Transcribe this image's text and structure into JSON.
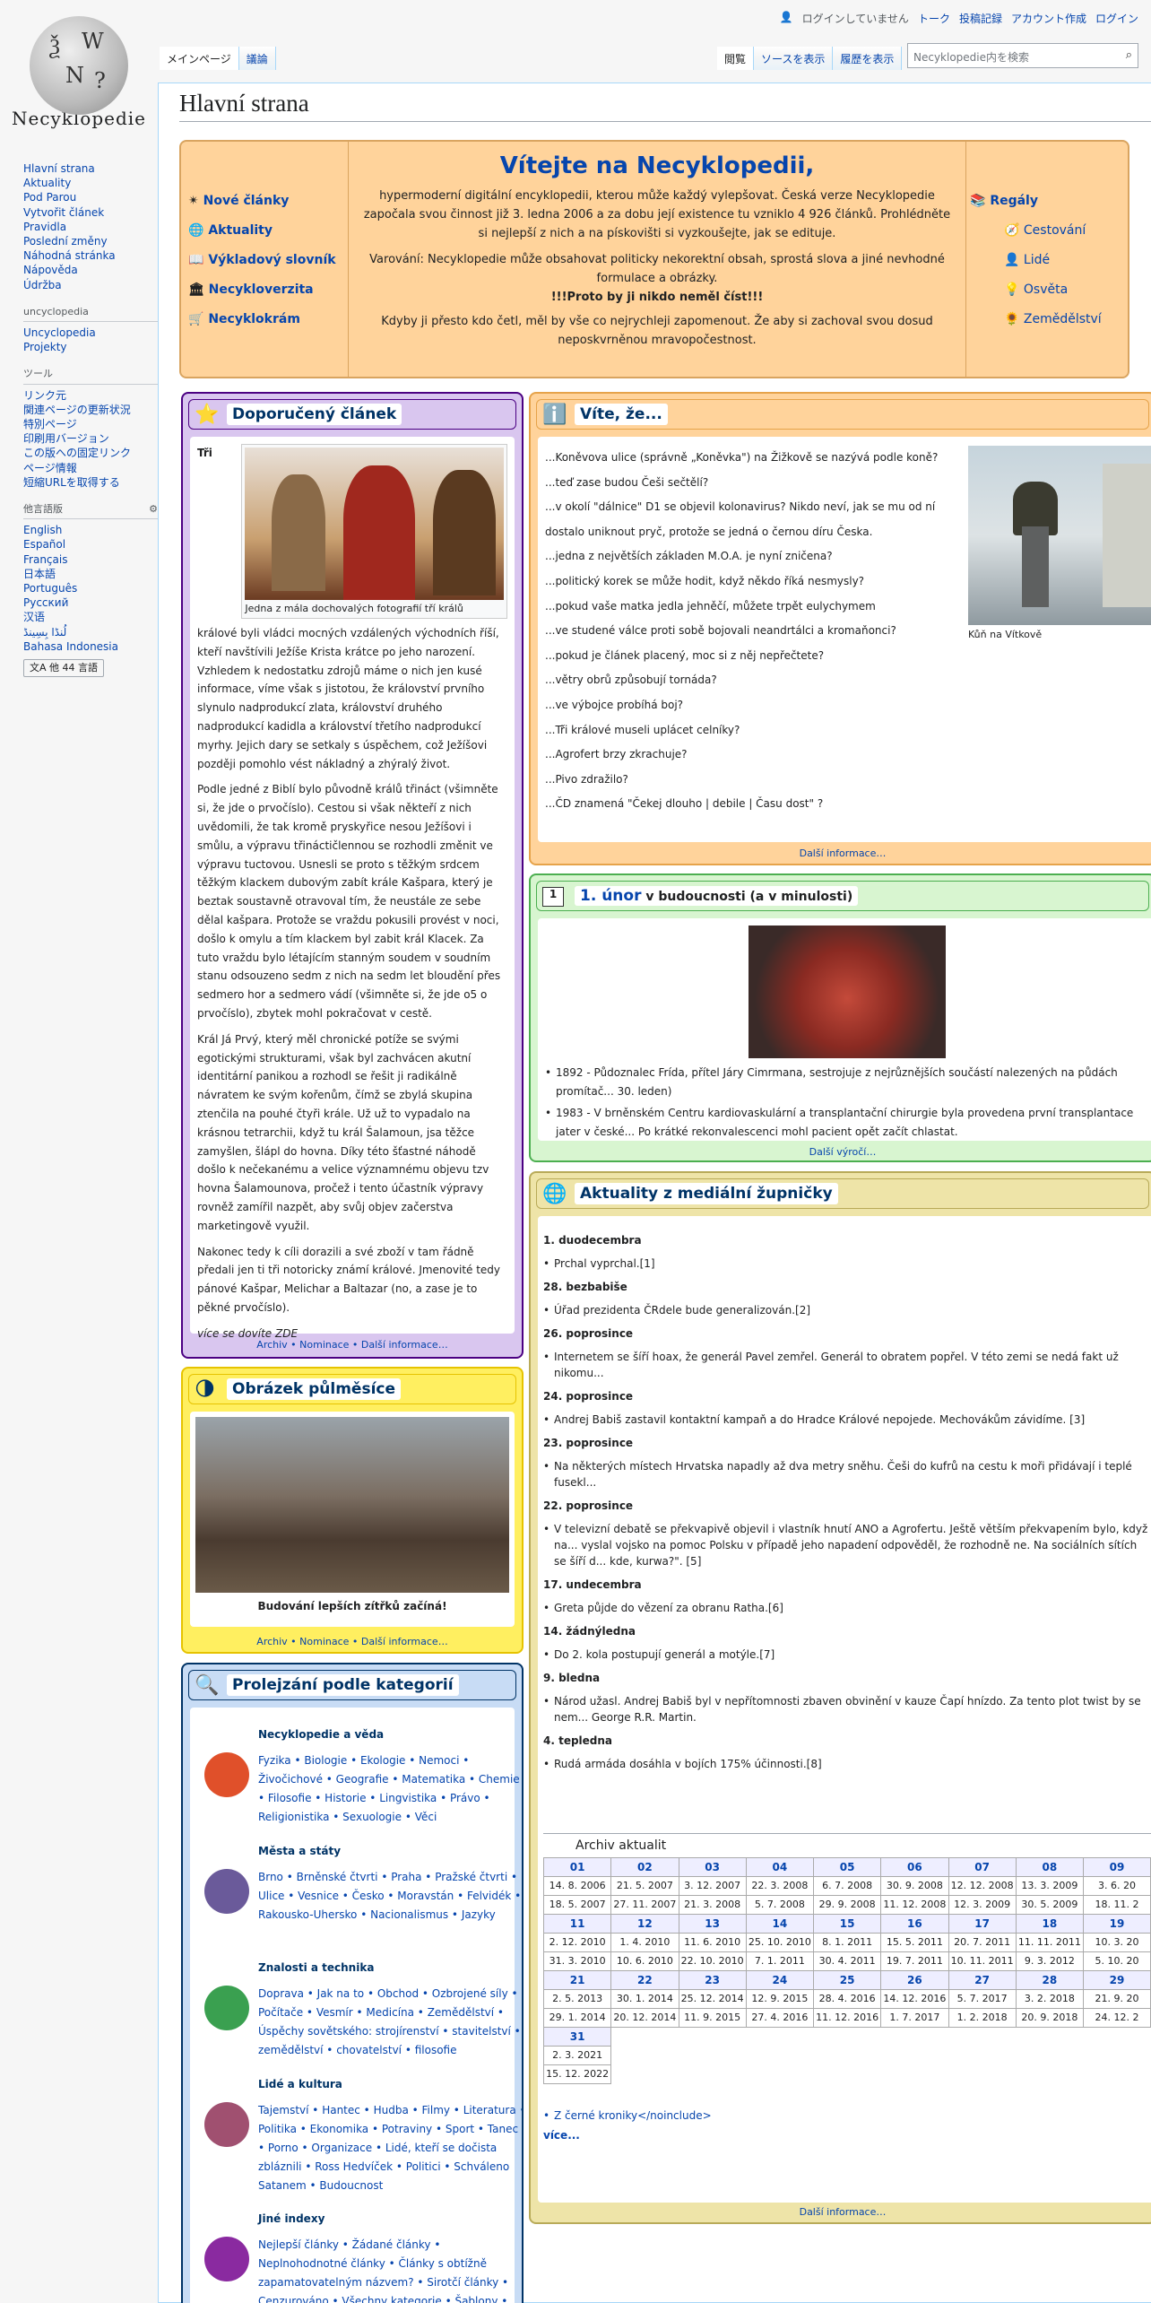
{
  "header": {
    "logo_word": "Necyklopedie",
    "personal": [
      "ログインしていません",
      "トーク",
      "投稿記録",
      "アカウント作成",
      "ログイン"
    ],
    "tabs_left": [
      "メインページ",
      "議論"
    ],
    "tabs_right": [
      "閲覧",
      "ソースを表示",
      "履歴を表示"
    ],
    "search_placeholder": "Necyklopedie内を検索"
  },
  "sidebar": {
    "main": [
      "Hlavní strana",
      "Aktuality",
      "Pod Parou",
      "Vytvořit článek",
      "Pravidla",
      "Poslední změny",
      "Náhodná stránka",
      "Nápověda",
      "Údržba"
    ],
    "uncy_head": "uncyclopedia",
    "uncy": [
      "Uncyclopedia",
      "Projekty"
    ],
    "tools_head": "ツール",
    "tools": [
      "リンク元",
      "関連ページの更新状況",
      "特別ページ",
      "印刷用バージョン",
      "この版への固定リンク",
      "ページ情報",
      "短縮URLを取得する"
    ],
    "lang_head": "他言語版",
    "langs": [
      "English",
      "Español",
      "Français",
      "日本語",
      "Português",
      "Русский",
      "汉语",
      "لُنڈا بِسِینڈ",
      "Bahasa Indonesia"
    ],
    "lang_button": "他 44 言語"
  },
  "page_title": "Hlavní strana",
  "welcome": {
    "title": "Vítejte na Necyklopedii,",
    "text1": "hypermoderní digitální encyklopedii, kterou může každý vylepšovat. Česká verze Necyklopedie započala svou činnost již 3. ledna 2006 a za dobu její existence tu vzniklo 4 926 článků. Prohlédněte si nejlepší z nich a na pískovišti si vyzkoušejte, jak se edituje.",
    "text2": "Varování: Necyklopedie může obsahovat politicky nekorektní obsah, sprostá slova a jiné nevhodné formulace a obrázky.",
    "text3": "!!!Proto by ji nikdo neměl číst!!!",
    "text4": "Kdyby ji přesto kdo četl, měl by vše co nejrychleji zapomenout. Že aby si zachoval svou dosud neposkvrněnou mravopočestnost.",
    "left": [
      "Nové články",
      "Aktuality",
      "Výkladový slovník",
      "Necykloverzita",
      "Necyklokrám"
    ],
    "right_head": "Regály",
    "right": [
      "Cestování",
      "Lidé",
      "Osvěta",
      "Zemědělství"
    ]
  },
  "featured": {
    "title": "Doporučený článek",
    "first": "Tři",
    "caption": "Jedna z mála dochovalých fotografií tří králů",
    "p1": "králové byli vládci mocných vzdálených východních říší, kteří navštívili Ježíše Krista krátce po jeho narození. Vzhledem k nedostatku zdrojů máme o nich jen kusé informace, víme však s jistotou, že království prvního slynulo nadprodukcí zlata, království druhého nadprodukcí kadidla a království třetího nadprodukcí myrhy. Jejich dary se setkaly s úspěchem, což Ježíšovi později pomohlo vést nákladný a zhýralý život.",
    "p2": "Podle jedné z Biblí bylo původně králů třináct (všimněte si, že jde o prvočíslo). Cestou si však někteří z nich uvědomili, že tak kromě pryskyřice nesou Ježíšovi i smůlu, a výpravu třináctičlennou se rozhodli změnit ve výpravu tuctovou. Usnesli se proto s těžkým srdcem těžkým klackem dubovým zabít krále Kašpara, který je beztak soustavně otravoval tím, že neustále ze sebe dělal kašpara. Protože se vraždu pokusili provést v noci, došlo k omylu a tím klackem byl zabit král Klacek. Za tuto vraždu bylo létajícím stanným soudem v soudním stanu odsouzeno sedm z nich na sedm let bloudění přes sedmero hor a sedmero vádí (všimněte si, že jde o5 o prvočíslo), zbytek mohl pokračovat v cestě.",
    "p3": "Král Já Prvý, který měl chronické potíže se svými egotickými strukturami, však byl zachvácen akutní identitární panikou a rozhodl se řešit ji radikálně návratem ke svým kořenům, čímž se zbylá skupina ztenčila na pouhé čtyři krále. Už už to vypadalo na krásnou tetrarchii, když tu král Šalamoun, jsa těžce zamyšlen, šlápl do hovna. Díky této šťastné náhodě došlo k nečekanému a velice významnému objevu tzv hovna Šalamounova, pročež i tento účastník výpravy rovněž zamířil nazpět, aby svůj objev začerstva marketingově využil.",
    "p4": "Nakonec tedy k cíli dorazili a své zboží v tam řádně předali jen ti tři notoricky známí králové. Jmenovité tedy pánové Kašpar, Melichar a Baltazar (no, a zase je to pěkné prvočíslo).",
    "more": "více se dovíte ZDE",
    "footer": "Archiv • Nominace • Další informace…"
  },
  "halfmoon": {
    "title": "Obrázek půlměsíce",
    "caption": "Budování lepších zítřků začíná!",
    "footer": "Archiv • Nominace • Další informace…"
  },
  "categories": {
    "title": "Prolejzání podle kategorií",
    "groups": [
      {
        "head": "Necyklopedie a věda",
        "items": "Fyzika • Biologie • Ekologie • Nemoci • Živočichové • Geografie • Matematika • Chemie • Filosofie • Historie • Lingvistika • Právo • Religionistika • Sexuologie • Věci"
      },
      {
        "head": "Města a státy",
        "items": "Brno • Brněnské čtvrti • Praha • Pražské čtvrti • Ulice • Vesnice • Česko • Moravstán • Felvidék • Rakousko-Uhersko • Nacionalismus • Jazyky"
      },
      {
        "head": "Znalosti a technika",
        "items": "Doprava • Jak na to • Obchod • Ozbrojené síly • Počítače • Vesmír • Medicína • Zemědělství • Úspěchy sovětského: strojírenství • stavitelství • zemědělství • chovatelství • filosofie"
      },
      {
        "head": "Lidé a kultura",
        "items": "Tajemství • Hantec • Hudba • Filmy • Literatura • Politika • Ekonomika • Potraviny • Sport • Tanec • Porno • Organizace • Lidé, kteří se dočista zbláznili • Ross Hedvíček • Politici • Schváleno Satanem • Budoucnost"
      },
      {
        "head": "Jiné indexy",
        "items": "Nejlepší články • Žádané články • Neplnohodnotné články • Články s obtížně zapamatovatelným názvem? • Sirotčí články • Cenzurováno • Všechny kategorie • Šablony •"
      }
    ]
  },
  "didyouknow": {
    "title": "Víte, že...",
    "items": [
      "...Koněvova ulice (správně „Koněvka\") na Žižkově se nazývá podle koně?",
      "...teď zase budou Češi sečtělí?",
      "...v okolí \"dálnice\" D1 se objevil kolonavirus? Nikdo neví, jak se mu od ní dostalo uniknout pryč, protože se jedná o černou díru Česka.",
      "...jedna z největších základen M.O.A. je nyní zničena?",
      "...politický korek se může hodit, když někdo říká nesmysly?",
      "...pokud vaše matka jedla jehněčí, můžete trpět eulychymem",
      "...ve studené válce proti sobě bojovali neandrtálci a kromaňonci?",
      "...pokud je článek placený, moc si z něj nepřečtete?",
      "...větry obrů způsobují tornáda?",
      "...ve výbojce probíhá boj?",
      "...Tři králové museli uplácet celníky?",
      "...Agrofert brzy zkrachuje?",
      "...Pivo zdražilo?",
      "...ČD znamená \"Čekej dlouho | debile | Času dost\" ?"
    ],
    "image_caption": "Kůň na Vítkově",
    "footer": "Další informace…"
  },
  "anniversary": {
    "day": "1",
    "title_link": "1. únor",
    "title_rest": " v budoucnosti (a v minulosti)",
    "items": [
      "1892 - Půdoznalec Frída, přítel Járy Cimrmana, sestrojuje z nejrůznějších součástí nalezených na půdách promítač... 30. leden)",
      "1983 - V brněnském Centru kardiovaskulární a transplantační chirurgie byla provedena první transplantace jater v české... Po krátké rekonvalescenci mohl pacient opět začít chlastat."
    ],
    "footer": "Další výročí…"
  },
  "news": {
    "title": "Aktuality z mediální župničky",
    "entries": [
      {
        "date": "1. duodecembra",
        "text": "Prchal vyprchal.[1]"
      },
      {
        "date": "28. bezbabiše",
        "text": "Úřad prezidenta ČRdele bude generalizován.[2]"
      },
      {
        "date": "26. poprosince",
        "text": "Internetem se šíří hoax, že generál Pavel zemřel. Generál to obratem popřel. V této zemi se nedá fakt už nikomu..."
      },
      {
        "date": "24. poprosince",
        "text": "Andrej Babiš zastavil kontaktní kampaň a do Hradce Králové nepojede. Mechovákům závidíme. [3]"
      },
      {
        "date": "23. poprosince",
        "text": "Na některých místech Hrvatska napadly až dva metry sněhu. Češi do kufrů na cestu k moři přidávají i teplé fusekl..."
      },
      {
        "date": "22. poprosince",
        "text": "V televizní debatě se překvapivě objevil i vlastník hnutí ANO a Agrofertu. Ještě větším překvapením bylo, když na... vyslal vojsko na pomoc Polsku v případě jeho napadení odpověděl, že rozhodně ne. Na sociálních sítích se šíří d... kde, kurwa?\". [5]"
      },
      {
        "date": "17. undecembra",
        "text": "Greta půjde do vězení za obranu Ratha.[6]"
      },
      {
        "date": "14. žádnýledna",
        "text": "Do 2. kola postupují generál a motýle.[7]"
      },
      {
        "date": "9. bledna",
        "text": "Národ užasl. Andrej Babiš byl v nepřítomnosti zbaven obvinění v kauze Čapí hnízdo. Za tento plot twist by se nem... George R.R. Martin."
      },
      {
        "date": "4. tepledna",
        "text": "Rudá armáda dosáhla v bojích 175% účinnosti.[8]"
      }
    ],
    "archive_title": "Archiv aktualit",
    "calendar": [
      {
        "nums": [
          "01",
          "02",
          "03",
          "04",
          "05",
          "06",
          "07",
          "08",
          "09"
        ],
        "r1": [
          "14. 8. 2006",
          "21. 5. 2007",
          "3. 12. 2007",
          "22. 3. 2008",
          "6. 7. 2008",
          "30. 9. 2008",
          "12. 12. 2008",
          "13. 3. 2009",
          "3. 6. 20"
        ],
        "r2": [
          "18. 5. 2007",
          "27. 11. 2007",
          "21. 3. 2008",
          "5. 7. 2008",
          "29. 9. 2008",
          "11. 12. 2008",
          "12. 3. 2009",
          "30. 5. 2009",
          "18. 11. 2"
        ]
      },
      {
        "nums": [
          "11",
          "12",
          "13",
          "14",
          "15",
          "16",
          "17",
          "18",
          "19"
        ],
        "r1": [
          "2. 12. 2010",
          "1. 4. 2010",
          "11. 6. 2010",
          "25. 10. 2010",
          "8. 1. 2011",
          "15. 5. 2011",
          "20. 7. 2011",
          "11. 11. 2011",
          "10. 3. 20"
        ],
        "r2": [
          "31. 3. 2010",
          "10. 6. 2010",
          "22. 10. 2010",
          "7. 1. 2011",
          "30. 4. 2011",
          "19. 7. 2011",
          "10. 11. 2011",
          "9. 3. 2012",
          "5. 10. 20"
        ]
      },
      {
        "nums": [
          "21",
          "22",
          "23",
          "24",
          "25",
          "26",
          "27",
          "28",
          "29"
        ],
        "r1": [
          "2. 5. 2013",
          "30. 1. 2014",
          "25. 12. 2014",
          "12. 9. 2015",
          "28. 4. 2016",
          "14. 12. 2016",
          "5. 7. 2017",
          "3. 2. 2018",
          "21. 9. 20"
        ],
        "r2": [
          "29. 1. 2014",
          "20. 12. 2014",
          "11. 9. 2015",
          "27. 4. 2016",
          "11. 12. 2016",
          "1. 7. 2017",
          "1. 2. 2018",
          "20. 9. 2018",
          "24. 12. 2"
        ]
      },
      {
        "nums": [
          "31"
        ],
        "r1": [
          "2. 3. 2021"
        ],
        "r2": [
          "15. 12. 2022"
        ]
      }
    ],
    "bottom_link": "Z černé kroniky</noinclude>",
    "more": "více...",
    "footer": "Další informace…"
  }
}
